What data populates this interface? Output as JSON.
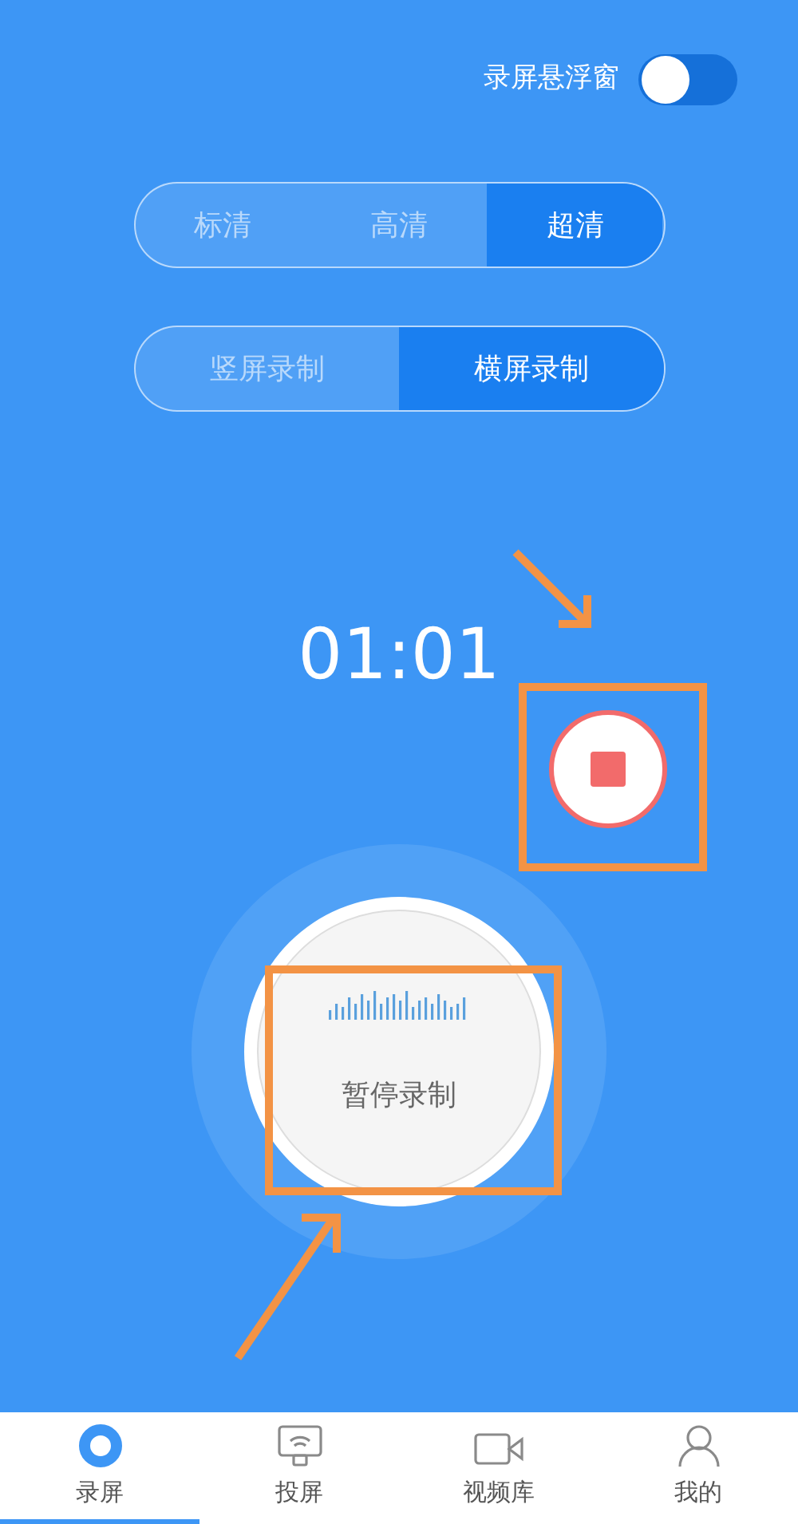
{
  "floating_window": {
    "label": "录屏悬浮窗",
    "on": false
  },
  "quality_tabs": [
    {
      "label": "标清",
      "selected": false
    },
    {
      "label": "高清",
      "selected": false
    },
    {
      "label": "超清",
      "selected": true
    }
  ],
  "orientation_tabs": [
    {
      "label": "竖屏录制",
      "selected": false
    },
    {
      "label": "横屏录制",
      "selected": true
    }
  ],
  "timer": "01:01",
  "pause_button": {
    "label": "暂停录制"
  },
  "bottom_nav": [
    {
      "label": "录屏",
      "kind": "record",
      "selected": true
    },
    {
      "label": "投屏",
      "kind": "cast",
      "selected": false
    },
    {
      "label": "视频库",
      "kind": "video",
      "selected": false
    },
    {
      "label": "我的",
      "kind": "user",
      "selected": false
    }
  ]
}
